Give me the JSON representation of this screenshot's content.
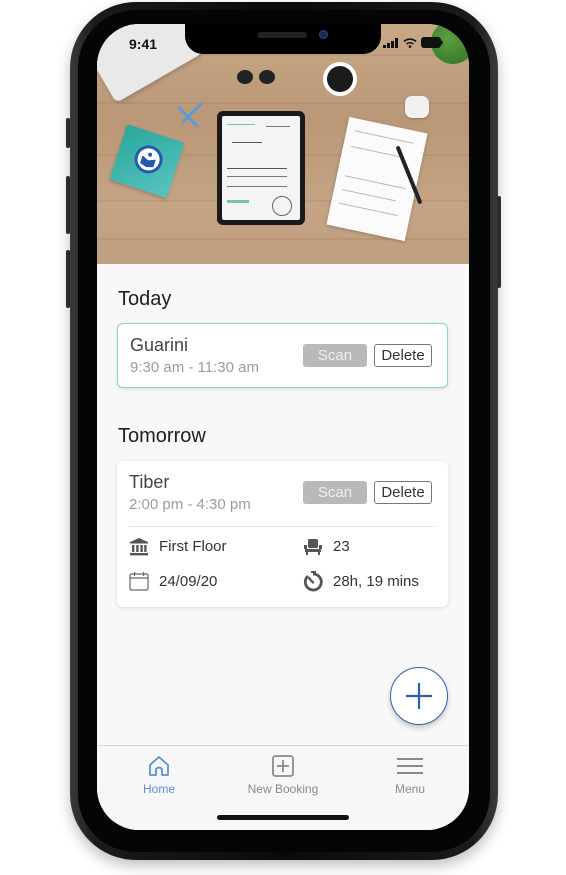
{
  "status_bar": {
    "time": "9:41",
    "icons": [
      "cellular-signal-icon",
      "wifi-icon",
      "battery-icon"
    ]
  },
  "hero": {
    "description": "desk flat-lay with tablet, notes, coffee, sunglasses, book with app logo"
  },
  "sections": [
    {
      "title": "Today",
      "bookings": [
        {
          "name": "Guarini",
          "time": "9:30 am - 11:30 am",
          "scan_label": "Scan",
          "delete_label": "Delete",
          "highlighted": true
        }
      ]
    },
    {
      "title": "Tomorrow",
      "bookings": [
        {
          "name": "Tiber",
          "time": "2:00 pm - 4:30 pm",
          "scan_label": "Scan",
          "delete_label": "Delete",
          "details": {
            "floor": "First Floor",
            "seat": "23",
            "date": "24/09/20",
            "countdown": "28h, 19 mins"
          },
          "detail_icons": {
            "floor": "building-icon",
            "seat": "seat-icon",
            "date": "calendar-icon",
            "countdown": "timer-icon"
          }
        }
      ]
    }
  ],
  "fab": {
    "icon": "plus-icon"
  },
  "tabbar": {
    "items": [
      {
        "label": "Home",
        "icon": "home-icon",
        "active": true
      },
      {
        "label": "New Booking",
        "icon": "plus-square-icon",
        "active": false
      },
      {
        "label": "Menu",
        "icon": "hamburger-icon",
        "active": false
      }
    ]
  },
  "colors": {
    "accent": "#2f5fb3",
    "tab_active": "#5b8fd6",
    "highlight_border": "#86d9c3",
    "scan_disabled": "#b9b9b9"
  }
}
